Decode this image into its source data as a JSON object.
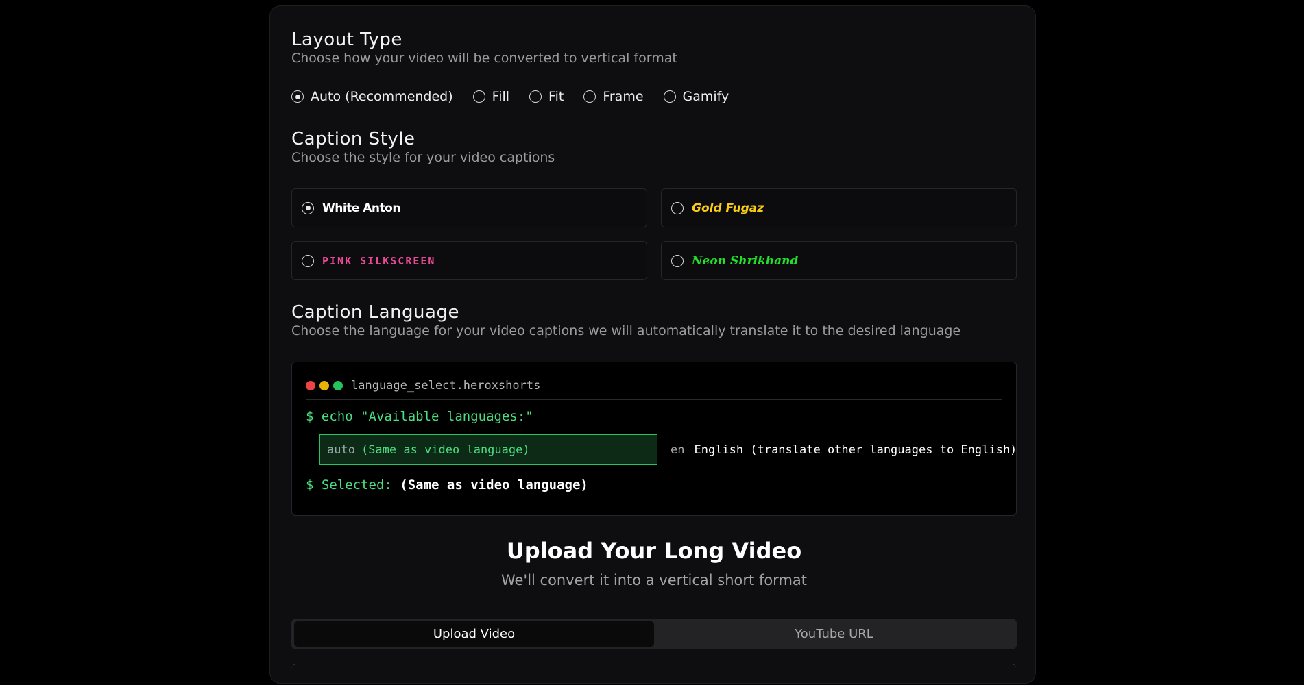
{
  "layout": {
    "title": "Layout Type",
    "description": "Choose how your video will be converted to vertical format",
    "options": [
      {
        "label": "Auto (Recommended)",
        "selected": true
      },
      {
        "label": "Fill",
        "selected": false
      },
      {
        "label": "Fit",
        "selected": false
      },
      {
        "label": "Frame",
        "selected": false
      },
      {
        "label": "Gamify",
        "selected": false
      }
    ]
  },
  "caption_style": {
    "title": "Caption Style",
    "description": "Choose the style for your video captions",
    "options": [
      {
        "label": "White Anton",
        "selected": true,
        "color": "#ffffff"
      },
      {
        "label": "Gold Fugaz",
        "selected": false,
        "color": "#facc15"
      },
      {
        "label": "PINK SILKSCREEN",
        "selected": false,
        "color": "#ec4899"
      },
      {
        "label": "Neon Shrikhand",
        "selected": false,
        "color": "#22e02a"
      }
    ]
  },
  "caption_language": {
    "title": "Caption Language",
    "description": "Choose the language for your video captions we will automatically translate it to the desired language",
    "terminal": {
      "title": "language_select.heroxshorts",
      "command": "$ echo \"Available languages:\"",
      "options": [
        {
          "code": "auto",
          "name": "(Same as video language)",
          "selected": true
        },
        {
          "code": "en",
          "name": "English (translate other languages to English)",
          "selected": false
        }
      ],
      "selected_prefix": "$ Selected:",
      "selected_value": "(Same as video language)"
    }
  },
  "upload": {
    "title": "Upload Your Long Video",
    "subtitle": "We'll convert it into a vertical short format",
    "tabs": [
      {
        "label": "Upload Video",
        "active": true
      },
      {
        "label": "YouTube URL",
        "active": false
      }
    ]
  },
  "colors": {
    "accent_green": "#4ade80",
    "traffic_red": "#ef4444",
    "traffic_yellow": "#eab308",
    "traffic_green": "#22c55e"
  }
}
